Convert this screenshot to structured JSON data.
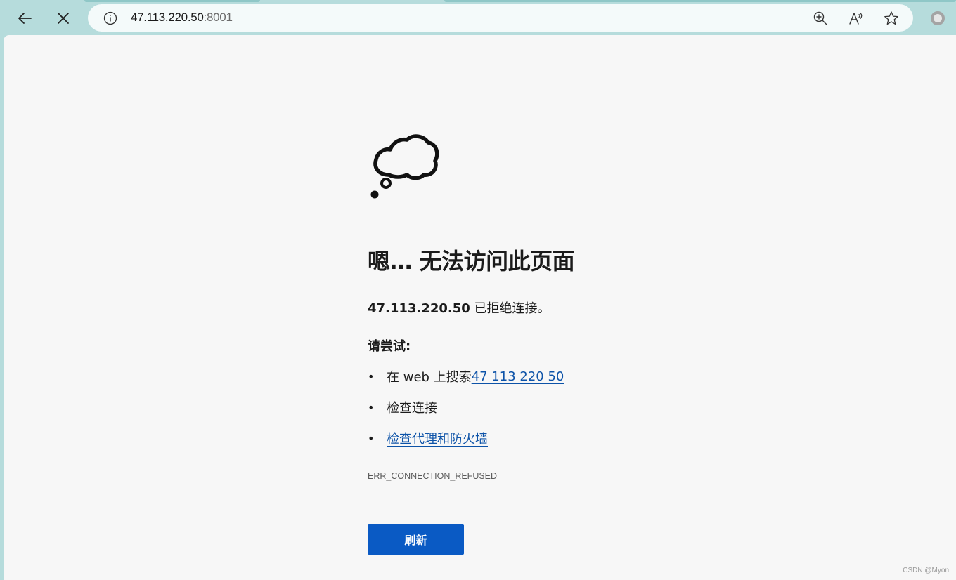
{
  "browser": {
    "address_bar": {
      "host": "47.113.220.50",
      "port": ":8001"
    },
    "icons": {
      "back": "back-arrow-icon",
      "stop": "close-icon",
      "info": "info-icon",
      "zoom": "zoom-in-icon",
      "read_aloud": "read-aloud-icon",
      "favorite": "star-icon",
      "profile": "profile-icon"
    }
  },
  "error_page": {
    "illustration": "thought-cloud-icon",
    "heading": "嗯… 无法访问此页面",
    "host_bold": "47.113.220.50",
    "refused_text": " 已拒绝连接。",
    "try_label": "请尝试:",
    "suggestions": {
      "search_prefix": "在 web 上搜索 ",
      "search_link": "47 113 220 50",
      "check_connection": "检查连接",
      "check_proxy": "检查代理和防火墙"
    },
    "error_code": "ERR_CONNECTION_REFUSED",
    "refresh_label": "刷新"
  },
  "watermark": "CSDN @Myon⁠⁠",
  "colors": {
    "chrome": "#b6dcdc",
    "page": "#f7f7f7",
    "link": "#0d53a8",
    "button": "#0a5ac4"
  }
}
